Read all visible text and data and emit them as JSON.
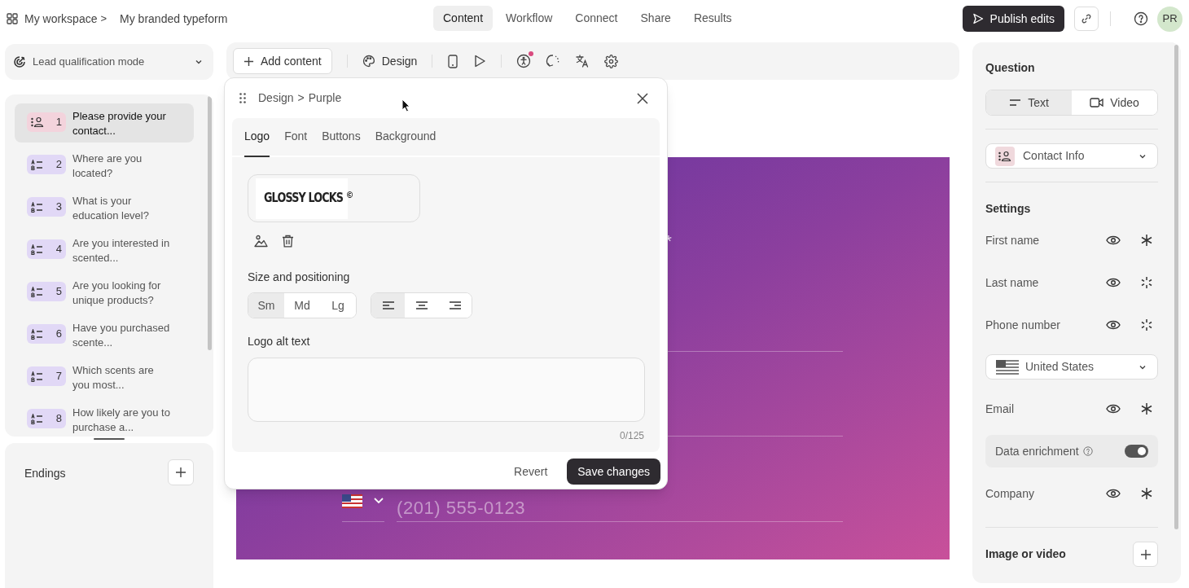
{
  "breadcrumb": {
    "workspace": "My workspace",
    "separator": ">",
    "form": "My branded typeform"
  },
  "nav_tabs": [
    {
      "label": "Content",
      "selected": true
    },
    {
      "label": "Workflow",
      "selected": false
    },
    {
      "label": "Connect",
      "selected": false
    },
    {
      "label": "Share",
      "selected": false
    },
    {
      "label": "Results",
      "selected": false
    }
  ],
  "publish_button": "Publish edits",
  "avatar": "PR",
  "mode_selector": "Lead qualification mode",
  "questions": [
    {
      "number": "1",
      "text": "Please provide your contact...",
      "kind": "contact",
      "selected": true
    },
    {
      "number": "2",
      "text": "Where are you located?",
      "kind": "choice",
      "selected": false
    },
    {
      "number": "3",
      "text": "What is your education level?",
      "kind": "choice",
      "selected": false
    },
    {
      "number": "4",
      "text": "Are you interested in scented...",
      "kind": "choice",
      "selected": false
    },
    {
      "number": "5",
      "text": "Are you looking for unique products?",
      "kind": "choice",
      "selected": false
    },
    {
      "number": "6",
      "text": "Have you purchased scente...",
      "kind": "choice",
      "selected": false
    },
    {
      "number": "7",
      "text": "Which scents are you most...",
      "kind": "choice",
      "selected": false
    },
    {
      "number": "8",
      "text": "How likely are you to purchase a...",
      "kind": "choice",
      "selected": false
    }
  ],
  "endings": {
    "title": "Endings"
  },
  "toolbar": {
    "add_content": "Add content",
    "design": "Design",
    "accessibility_alert": true
  },
  "design_popup": {
    "section": "Design",
    "separator": ">",
    "theme": "Purple",
    "tabs": [
      {
        "label": "Logo",
        "selected": true
      },
      {
        "label": "Font",
        "selected": false
      },
      {
        "label": "Buttons",
        "selected": false
      },
      {
        "label": "Background",
        "selected": false
      }
    ],
    "logo": "GLOSSY LOCKS $^{©}$",
    "size_label": "Size and positioning",
    "sizes": [
      {
        "label": "Sm",
        "selected": true
      },
      {
        "label": "Md",
        "selected": false
      },
      {
        "label": "Lg",
        "selected": false
      }
    ],
    "alignments": [
      {
        "kind": "left",
        "selected": true
      },
      {
        "kind": "center",
        "selected": false
      },
      {
        "kind": "right",
        "selected": false
      }
    ],
    "alt_label": "Logo alt text",
    "alt_counter": "0/125",
    "revert": "Revert",
    "save": "Save changes"
  },
  "canvas": {
    "required_mark": "*",
    "phone_placeholder": "(201) 555-0123"
  },
  "question_panel": {
    "title": "Question",
    "media_tabs": [
      {
        "label": "Text",
        "kind": "text",
        "selected": true
      },
      {
        "label": "Video",
        "kind": "video",
        "selected": false
      }
    ],
    "question_type": "Contact Info",
    "settings_title": "Settings",
    "settings": [
      {
        "kind": "field",
        "label": "First name",
        "visible": true,
        "required": true
      },
      {
        "kind": "field",
        "label": "Last name",
        "visible": true,
        "required": false
      },
      {
        "kind": "field",
        "label": "Phone number",
        "visible": true,
        "required": false
      },
      {
        "kind": "country",
        "label": "United States"
      },
      {
        "kind": "field",
        "label": "Email",
        "visible": true,
        "required": true
      },
      {
        "kind": "toggle",
        "label": "Data enrichment",
        "on": true
      },
      {
        "kind": "field",
        "label": "Company",
        "visible": true,
        "required": true
      }
    ],
    "media_title": "Image or video"
  }
}
